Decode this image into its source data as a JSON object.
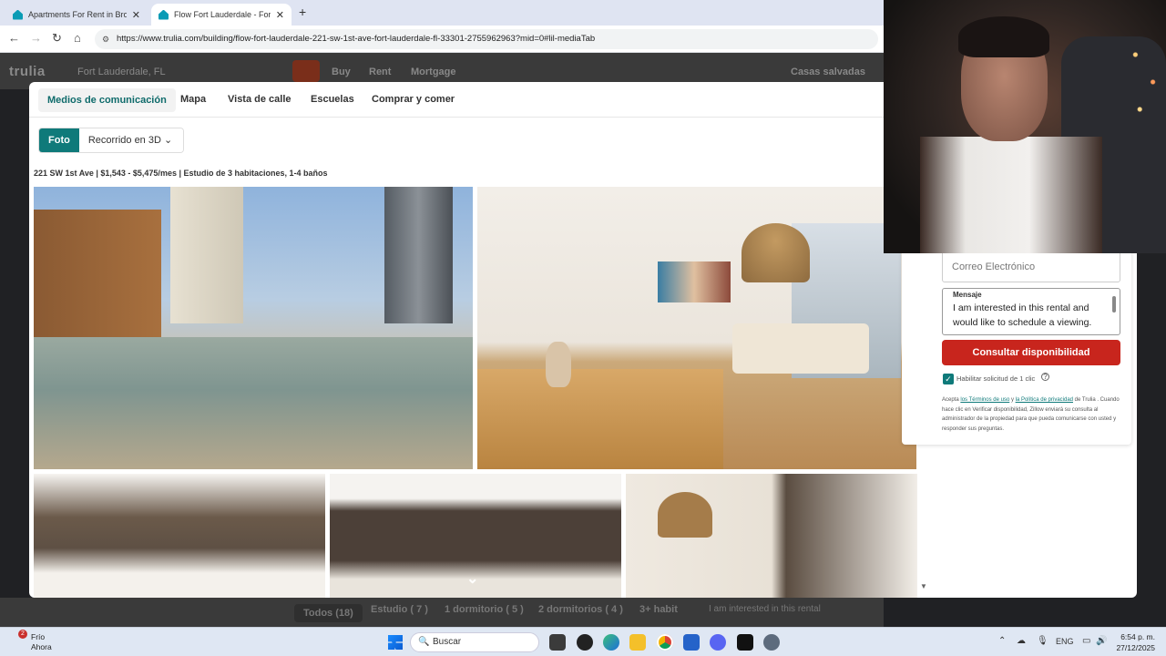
{
  "browser": {
    "tabs": [
      {
        "title": "Apartments For Rent in Browar",
        "active": false
      },
      {
        "title": "Flow Fort Lauderdale - Fort La",
        "active": true
      }
    ],
    "url": "https://www.trulia.com/building/flow-fort-lauderdale-221-sw-1st-ave-fort-lauderdale-fl-33301-2755962963?mid=0#lil-mediaTab"
  },
  "site": {
    "logo": "trulia",
    "location": "Fort Lauderdale, FL",
    "nav": [
      "Buy",
      "Rent",
      "Mortgage"
    ],
    "saved": "Casas salvadas"
  },
  "modal": {
    "tabs": [
      "Medios de comunicación",
      "Mapa",
      "Vista de calle",
      "Escuelas",
      "Comprar y comer"
    ],
    "view_toggle": {
      "photo": "Foto",
      "tour": "Recorrido en 3D"
    },
    "caption": "221 SW 1st Ave | $1,543 - $5,475/mes | Estudio de 3 habitaciones, 1-4 baños"
  },
  "contact_form": {
    "email_placeholder": "Correo Electrónico",
    "message_label": "Mensaje",
    "message_text": "I am interested in this rental and would like to schedule a viewing.",
    "cta": "Consultar disponibilidad",
    "one_click_label": "Habilitar solicitud de 1 clic",
    "one_click_checked": true,
    "legal_prefix": "Acepta ",
    "legal_terms": "los Términos de uso",
    "legal_and": " y ",
    "legal_privacy": "la Política de privacidad",
    "legal_rest": " de Trulia . Cuando hace clic en Verificar disponibilidad, Zillow enviará su consulta al administrador de la propiedad para que pueda comunicarse con usted y responder sus preguntas."
  },
  "background_filters": [
    "Todos (18)",
    "Estudio ( 7 )",
    "1 dormitorio ( 5 )",
    "2 dormitorios ( 4 )",
    "3+ habit"
  ],
  "background_message": "I am interested in this rental",
  "taskbar": {
    "weather_temp": "Frío",
    "weather_time": "Ahora",
    "weather_badge": "2",
    "search": "Buscar",
    "lang": "ENG",
    "time": "6:54 p. m.",
    "date": "27/12/2025"
  },
  "colors": {
    "teal": "#0f7a7a",
    "cta_red": "#c8251d"
  }
}
